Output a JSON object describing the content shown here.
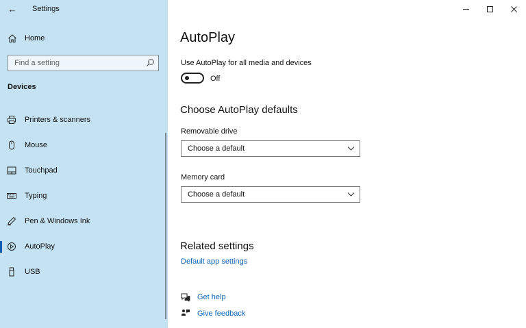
{
  "window": {
    "title": "Settings",
    "back_glyph": "←",
    "controls": {
      "minimize": "minimize-icon",
      "maximize": "maximize-icon",
      "close": "close-icon"
    }
  },
  "sidebar": {
    "home_label": "Home",
    "search_placeholder": "Find a setting",
    "section": "Devices",
    "items": [
      {
        "label": "Printers & scanners",
        "icon": "printer-icon"
      },
      {
        "label": "Mouse",
        "icon": "mouse-icon"
      },
      {
        "label": "Touchpad",
        "icon": "touchpad-icon"
      },
      {
        "label": "Typing",
        "icon": "keyboard-icon"
      },
      {
        "label": "Pen & Windows Ink",
        "icon": "pen-icon"
      },
      {
        "label": "AutoPlay",
        "icon": "autoplay-icon",
        "selected": true
      },
      {
        "label": "USB",
        "icon": "usb-icon"
      }
    ]
  },
  "main": {
    "title": "AutoPlay",
    "toggle": {
      "label": "Use AutoPlay for all media and devices",
      "state": "Off",
      "on": false
    },
    "defaults_heading": "Choose AutoPlay defaults",
    "removable": {
      "label": "Removable drive",
      "value": "Choose a default"
    },
    "memory": {
      "label": "Memory card",
      "value": "Choose a default"
    },
    "related_heading": "Related settings",
    "related_link": "Default app settings",
    "get_help": "Get help",
    "give_feedback": "Give feedback"
  },
  "colors": {
    "sidebar_bg": "#c5e2f2",
    "accent": "#0b5cad",
    "link": "#0b64b4"
  }
}
